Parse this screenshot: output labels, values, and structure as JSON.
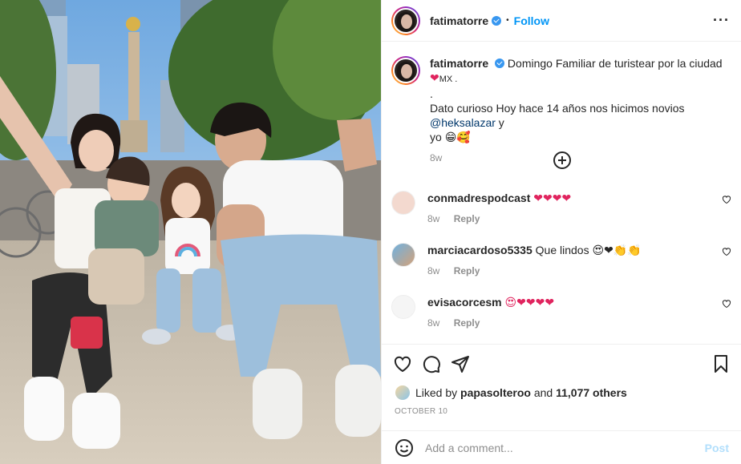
{
  "post": {
    "username": "fatimatorre",
    "follow_label": "Follow",
    "more_icon": "more-horizontal-icon",
    "caption": {
      "username": "fatimatorre",
      "line1": "Domingo Familiar de turistear por la ciudad",
      "line1_suffix": "MX .",
      "line2": ".",
      "line3": "Dato curioso Hoy hace 14 años nos hicimos novios",
      "mention": "@heksalazar",
      "line3_end": " y",
      "line4": "yo",
      "time": "8w"
    },
    "comments": [
      {
        "username": "conmadrespodcast",
        "text": "❤❤❤❤",
        "time": "8w",
        "reply": "Reply"
      },
      {
        "username": "marciacardoso5335",
        "text": "Que lindos 😍❤👏👏",
        "time": "8w",
        "reply": "Reply"
      },
      {
        "username": "evisacorcesm",
        "text": "😍❤❤❤❤",
        "time": "8w",
        "reply": "Reply"
      }
    ],
    "likes": {
      "prefix": "Liked by",
      "user": "papasolteroo",
      "and": "and",
      "count": "11,077 others"
    },
    "date": "OCTOBER 10",
    "add_comment_placeholder": "Add a comment...",
    "post_label": "Post",
    "colors": {
      "accent": "#0095f6",
      "heart": "#ed4956",
      "muted": "#8e8e8e"
    }
  }
}
